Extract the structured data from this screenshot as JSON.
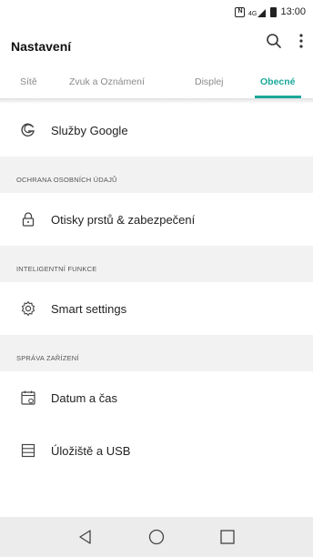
{
  "status_bar": {
    "time": "13:00",
    "nfc": "N"
  },
  "app_bar": {
    "title": "Nastavení"
  },
  "tabs": [
    {
      "label": "Sítě"
    },
    {
      "label": "Zvuk a Oznámení"
    },
    {
      "label": "Displej"
    },
    {
      "label": "Obecné",
      "active": true
    }
  ],
  "items": {
    "google": {
      "label": "Služby Google",
      "icon": "google-icon"
    },
    "section_privacy": "OCHRANA OSOBNÍCH ÚDAJŮ",
    "fingerprint": {
      "label": "Otisky prstů & zabezpečení",
      "icon": "lock-icon"
    },
    "section_smart": "INTELIGENTNÍ FUNKCE",
    "smart": {
      "label": "Smart settings",
      "icon": "gear-icon"
    },
    "section_device": "SPRÁVA ZAŘÍZENÍ",
    "datetime": {
      "label": "Datum a čas",
      "icon": "calendar-icon"
    },
    "storage": {
      "label": "Úložiště a USB",
      "icon": "storage-icon"
    }
  },
  "colors": {
    "accent": "#1aa89a"
  },
  "nav": [
    "back-icon",
    "home-icon",
    "recents-icon"
  ]
}
